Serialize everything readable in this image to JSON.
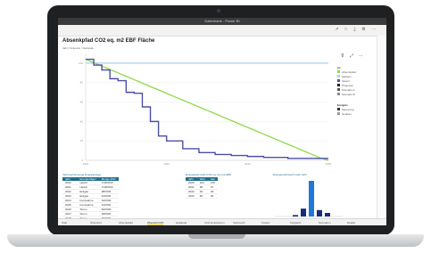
{
  "app": {
    "titlebar_text": "Datenbank - Power BI"
  },
  "report": {
    "title": "Absenkpfad CO2 eq. m2 EBF Fläche",
    "filters": "Jahr | Szenario | Gebäude"
  },
  "legend": {
    "title": "Ist",
    "items": [
      {
        "label": "Absenkpfad",
        "color": "#8ed94a"
      },
      {
        "label": "Zielwert",
        "color": "#a7d3ee"
      },
      {
        "label": "Istwert",
        "color": "#4c4fa6"
      },
      {
        "label": "Prognose",
        "color": "#222222"
      },
      {
        "label": "Szenario A",
        "color": "#555555"
      },
      {
        "label": "Szenario B",
        "color": "#888888"
      }
    ],
    "title2": "Ereignis",
    "items2": [
      {
        "label": "Sanierung",
        "color": "#333333"
      },
      {
        "label": "Neubau",
        "color": "#999999"
      }
    ]
  },
  "chart_data": {
    "type": "line",
    "title": "Absenkpfad CO2 eq. m2 EBF Fläche",
    "x": [
      2020,
      2021,
      2022,
      2023,
      2024,
      2025,
      2026,
      2027,
      2028,
      2029,
      2030,
      2031,
      2032,
      2033,
      2034,
      2035,
      2036,
      2037,
      2038,
      2039,
      2040,
      2041,
      2042,
      2043,
      2044,
      2045,
      2046,
      2047,
      2048,
      2049,
      2050
    ],
    "series": [
      {
        "name": "Zielwert",
        "color": "#a7d3ee",
        "values": [
          100,
          100,
          100,
          100,
          100,
          100,
          100,
          100,
          100,
          100,
          100,
          100,
          100,
          100,
          100,
          100,
          100,
          100,
          100,
          100,
          100,
          100,
          100,
          100,
          100,
          100,
          100,
          100,
          100,
          100,
          100
        ]
      },
      {
        "name": "Absenkpfad",
        "color": "#8ed94a",
        "values": [
          104,
          100.5,
          97,
          93.5,
          90,
          86.5,
          83,
          79.5,
          76,
          72.5,
          69,
          65.5,
          62,
          58.5,
          55,
          51.5,
          48,
          44.5,
          41,
          37.5,
          34,
          30.5,
          27,
          23.5,
          20,
          16.5,
          13,
          9.5,
          6,
          2.5,
          0
        ]
      },
      {
        "name": "Istwert",
        "color": "#4c4fa6",
        "values": [
          104,
          98,
          93,
          84,
          82,
          70,
          69,
          55,
          40,
          25,
          20,
          20,
          12,
          12,
          8,
          8,
          6,
          6,
          5,
          5,
          4,
          4,
          3,
          3,
          3,
          2,
          2,
          2,
          2,
          2,
          2
        ]
      }
    ],
    "ylim": [
      0,
      110
    ]
  },
  "panels": [
    {
      "title": "Verbrauchsmenge Energieträger",
      "columns": [
        "Jahr",
        "Energieträger",
        "Menge kWh"
      ],
      "rows": [
        [
          "2020",
          "Heizöl",
          "1'240'000"
        ],
        [
          "2021",
          "Heizöl",
          "1'180'000"
        ],
        [
          "2022",
          "Erdgas",
          "980'000"
        ],
        [
          "2023",
          "Erdgas",
          "910'000"
        ],
        [
          "2024",
          "Fernwärme",
          "640'000"
        ],
        [
          "2025",
          "Fernwärme",
          "610'000"
        ],
        [
          "2026",
          "Strom",
          "520'000"
        ],
        [
          "2027",
          "Strom",
          "480'000"
        ],
        [
          "2028",
          "Strom",
          "450'000"
        ],
        [
          "2029",
          "Pellets",
          "310'000"
        ],
        [
          "Gesamt",
          "",
          "7'320'000"
        ]
      ]
    },
    {
      "title": "Energiekennzahl CO2 eq. pro m2 EBF",
      "columns": [
        "Jahr",
        "Wert",
        "Ziel"
      ],
      "rows": [
        [
          "2020",
          "104",
          "100"
        ],
        [
          "2021",
          "98",
          "97"
        ],
        [
          "2022",
          "93",
          "93"
        ],
        [
          "2023",
          "84",
          "90"
        ]
      ]
    },
    {
      "title": "Energieverbrauch nach Jahr",
      "bars": [
        {
          "label": "2020",
          "value": 4
        },
        {
          "label": "2021",
          "value": 22
        },
        {
          "label": "2022",
          "value": 100
        },
        {
          "label": "2023",
          "value": 18
        },
        {
          "label": "2024",
          "value": 10
        }
      ]
    }
  ],
  "tabs": [
    {
      "label": "Start",
      "active": false
    },
    {
      "label": "Übersicht",
      "active": false
    },
    {
      "label": "Absenkpfad",
      "active": false
    },
    {
      "label": "Übersicht KPI",
      "active": true
    },
    {
      "label": "Gebäude",
      "active": false
    },
    {
      "label": "CO2 Emissionen",
      "active": false
    },
    {
      "label": "Verbrauch",
      "active": false
    },
    {
      "label": "Kosten",
      "active": false
    },
    {
      "label": "Vergleich",
      "active": false
    },
    {
      "label": "Szenarien",
      "active": false
    },
    {
      "label": "Details",
      "active": false
    }
  ]
}
